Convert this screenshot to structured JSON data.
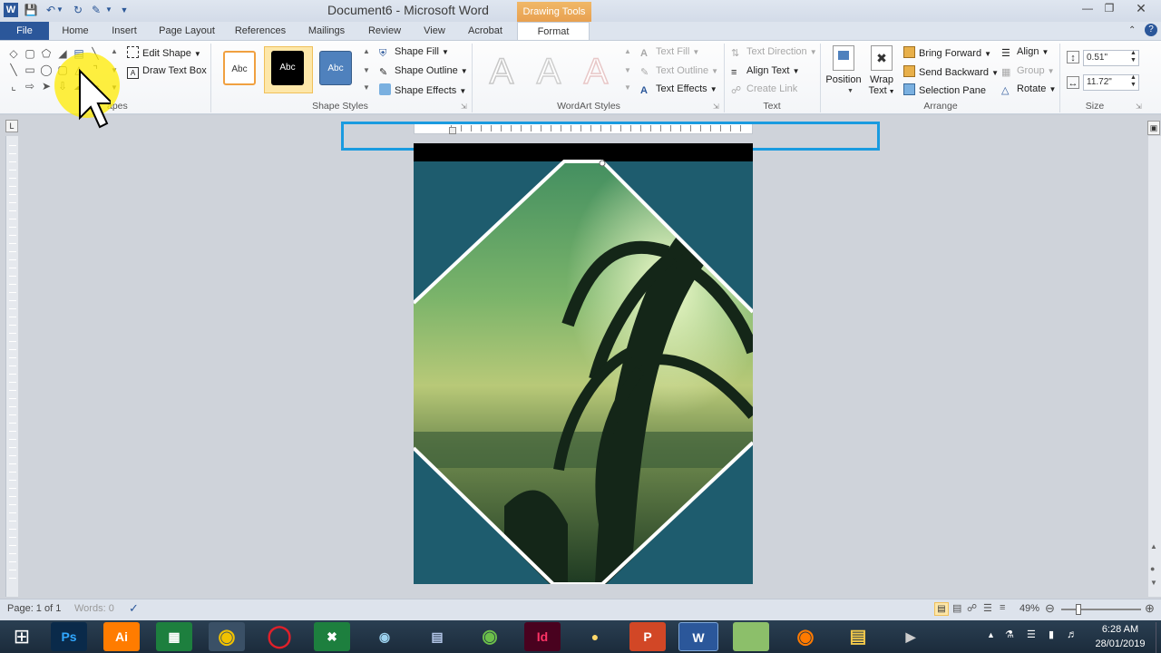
{
  "window": {
    "title": "Document6 - Microsoft Word",
    "contextual_tab_group": "Drawing Tools"
  },
  "tabs": [
    "File",
    "Home",
    "Insert",
    "Page Layout",
    "References",
    "Mailings",
    "Review",
    "View",
    "Acrobat",
    "Format"
  ],
  "active_tab": "Format",
  "ribbon": {
    "insert_shapes": {
      "edit_shape": "Edit Shape",
      "draw_text_box": "Draw Text Box",
      "label": "apes"
    },
    "shape_styles": {
      "presets": [
        "Abc",
        "Abc",
        "Abc"
      ],
      "shape_fill": "Shape Fill",
      "shape_outline": "Shape Outline",
      "shape_effects": "Shape Effects",
      "label": "Shape Styles"
    },
    "wordart_styles": {
      "label": "WordArt Styles",
      "text_fill": "Text Fill",
      "text_outline": "Text Outline",
      "text_effects": "Text Effects",
      "samples": [
        "A",
        "A",
        "A"
      ]
    },
    "text": {
      "text_direction": "Text Direction",
      "align_text": "Align Text",
      "create_link": "Create Link",
      "label": "Text"
    },
    "arrange": {
      "position": "Position",
      "wrap_text_1": "Wrap",
      "wrap_text_2": "Text",
      "bring_forward": "Bring Forward",
      "send_backward": "Send Backward",
      "selection_pane": "Selection Pane",
      "align": "Align",
      "group": "Group",
      "rotate": "Rotate",
      "label": "Arrange"
    },
    "size": {
      "height": "0.51\"",
      "width": "11.72\"",
      "label": "Size"
    }
  },
  "status": {
    "page": "Page: 1 of 1",
    "words": "Words: 0",
    "zoom": "49%"
  },
  "clock": {
    "time": "6:28 AM",
    "date": "28/01/2019"
  },
  "taskbar_apps": [
    "Ps",
    "Ai",
    "Excel",
    "Chrome",
    "Opera",
    "Excel",
    "Camera",
    "Photos",
    "Greenshot",
    "Id",
    "Messenger",
    "PowerPoint",
    "W",
    "Notes",
    "Firefox",
    "Explorer",
    "Video"
  ],
  "colors": {
    "accent": "#2b579a",
    "drawing_tools": "#e8a050",
    "selection_outline": "#1a9be0",
    "page_bg": "#1e5c6e"
  }
}
